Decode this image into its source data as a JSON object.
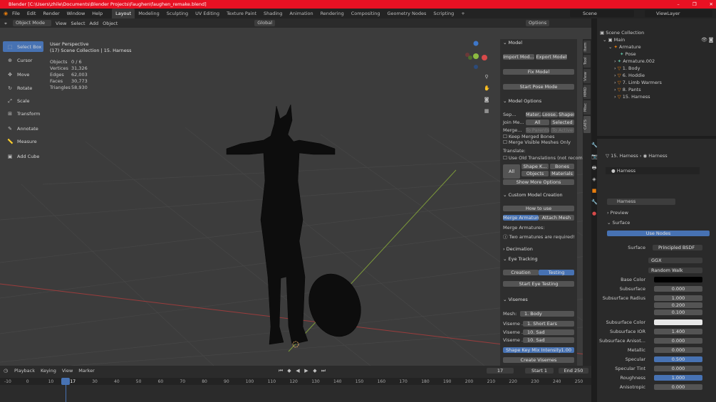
{
  "window": {
    "title": "Blender [C:\\Users\\zhile\\Documents\\Blender Projects\\Faughen\\faughen_remake.blend]",
    "controls": [
      "–",
      "❐",
      "✕"
    ]
  },
  "menu": [
    "File",
    "Edit",
    "Render",
    "Window",
    "Help"
  ],
  "workspaces": [
    "Layout",
    "Modeling",
    "Sculpting",
    "UV Editing",
    "Texture Paint",
    "Shading",
    "Animation",
    "Rendering",
    "Compositing",
    "Geometry Nodes",
    "Scripting",
    "+"
  ],
  "scene": {
    "label": "Scene",
    "view_layer": "ViewLayer"
  },
  "header": {
    "mode": "Object Mode",
    "view": "View",
    "select": "Select",
    "add": "Add",
    "object": "Object",
    "orientation": "Global",
    "options": "Options"
  },
  "viewport": {
    "title": "User Perspective",
    "subtitle": "(17) Scene Collection | 15. Harness",
    "stats": [
      {
        "k": "Objects",
        "v": "0 / 6"
      },
      {
        "k": "Vertices",
        "v": "31,326"
      },
      {
        "k": "Edges",
        "v": "62,003"
      },
      {
        "k": "Faces",
        "v": "30,773"
      },
      {
        "k": "Triangles",
        "v": "58,930"
      }
    ]
  },
  "tools": [
    "Select Box",
    "Cursor",
    "Move",
    "Rotate",
    "Scale",
    "Transform",
    "Annotate",
    "Measure",
    "Add Cube"
  ],
  "npanel": {
    "model": "Model",
    "import": "Import Mod...",
    "export": "Export Model",
    "fix": "Fix Model",
    "pose": "Start Pose Mode",
    "options": "Model Options",
    "sep": "Sep...",
    "mater": "Mater...",
    "loose": "Loose...",
    "shapes": "Shapes",
    "join": "Join Me...",
    "all": "All",
    "selected": "Selected",
    "merge": "Merge...",
    "to_parents": "To Parents",
    "to_active": "To Active",
    "keep": "Keep Merged Bones",
    "merge_vis": "Merge Visible Meshes Only",
    "translate": "Translate:",
    "old": "Use Old Translations (not recom...",
    "t_all": "All",
    "shapek": "Shape K...",
    "bones": "Bones",
    "objects": "Objects",
    "materials": "Materials",
    "more": "Show More Options",
    "custom": "Custom Model Creation",
    "howto": "How to use",
    "merge_arm": "Merge Armatures",
    "attach": "Attach Mesh",
    "merge_label": "Merge Armatures:",
    "warn": "Two armatures are required!",
    "decimation": "Decimation",
    "eye": "Eye Tracking",
    "creation": "Creation",
    "testing": "Testing",
    "start_eye": "Start Eye Testing",
    "visemes": "Visemes",
    "mesh_label": "Mesh:",
    "mesh": "1. Body",
    "vis": [
      {
        "k": "Viseme ...",
        "v": "1. Short Ears"
      },
      {
        "k": "Viseme ...",
        "v": "10. Sad"
      },
      {
        "k": "Viseme ...",
        "v": "10. Sad"
      }
    ],
    "intensity_label": "Shape Key Mix Intensity",
    "intensity": "1.00",
    "create": "Create Visemes"
  },
  "vtabs": [
    "Item",
    "Tool",
    "View",
    "MMD",
    "Misc",
    "CATS"
  ],
  "outliner": {
    "root": "Scene Collection",
    "items": [
      "Main",
      "Armature",
      "Pose",
      "Armature.002",
      "1. Body",
      "6. Hoddie",
      "7. Limb Warmers",
      "8. Pants",
      "15. Harness"
    ]
  },
  "properties": {
    "crumb_obj": "15. Harness",
    "crumb_mat": "Harness",
    "slot": "Harness",
    "material": "Harness",
    "preview": "Preview",
    "surface": "Surface",
    "use_nodes": "Use Nodes",
    "rows": [
      {
        "k": "Surface",
        "v": "Principled BSDF"
      },
      {
        "k": "",
        "v": "GGX"
      },
      {
        "k": "",
        "v": "Random Walk"
      },
      {
        "k": "Base Color",
        "v": ""
      },
      {
        "k": "Subsurface",
        "v": "0.000"
      },
      {
        "k": "Subsurface Radius",
        "v": "1.000"
      },
      {
        "k": "",
        "v": "0.200"
      },
      {
        "k": "",
        "v": "0.100"
      },
      {
        "k": "Subsurface Color",
        "v": ""
      },
      {
        "k": "Subsurface IOR",
        "v": "1.400"
      },
      {
        "k": "Subsurface Anisot...",
        "v": "0.000"
      },
      {
        "k": "Metallic",
        "v": "0.000"
      },
      {
        "k": "Specular",
        "v": "0.500"
      },
      {
        "k": "Specular Tint",
        "v": "0.000"
      },
      {
        "k": "Roughness",
        "v": "1.000"
      },
      {
        "k": "Anisotropic",
        "v": "0.000"
      }
    ]
  },
  "timeline": {
    "playback": "Playback",
    "keying": "Keying",
    "view": "View",
    "marker": "Marker",
    "frame": "17",
    "start_label": "Start",
    "start": "1",
    "end_label": "End",
    "end": "250",
    "ticks": [
      "-10",
      "0",
      "10",
      "17",
      "30",
      "40",
      "50",
      "60",
      "70",
      "80",
      "90",
      "100",
      "110",
      "120",
      "130",
      "140",
      "150",
      "160",
      "170",
      "180",
      "190",
      "200",
      "210",
      "220",
      "230",
      "240",
      "250"
    ]
  },
  "colors": {
    "accent": "#4772b3",
    "title": "#e81123",
    "x_axis": "#9b3c3c",
    "y_axis": "#7d9a3a"
  }
}
